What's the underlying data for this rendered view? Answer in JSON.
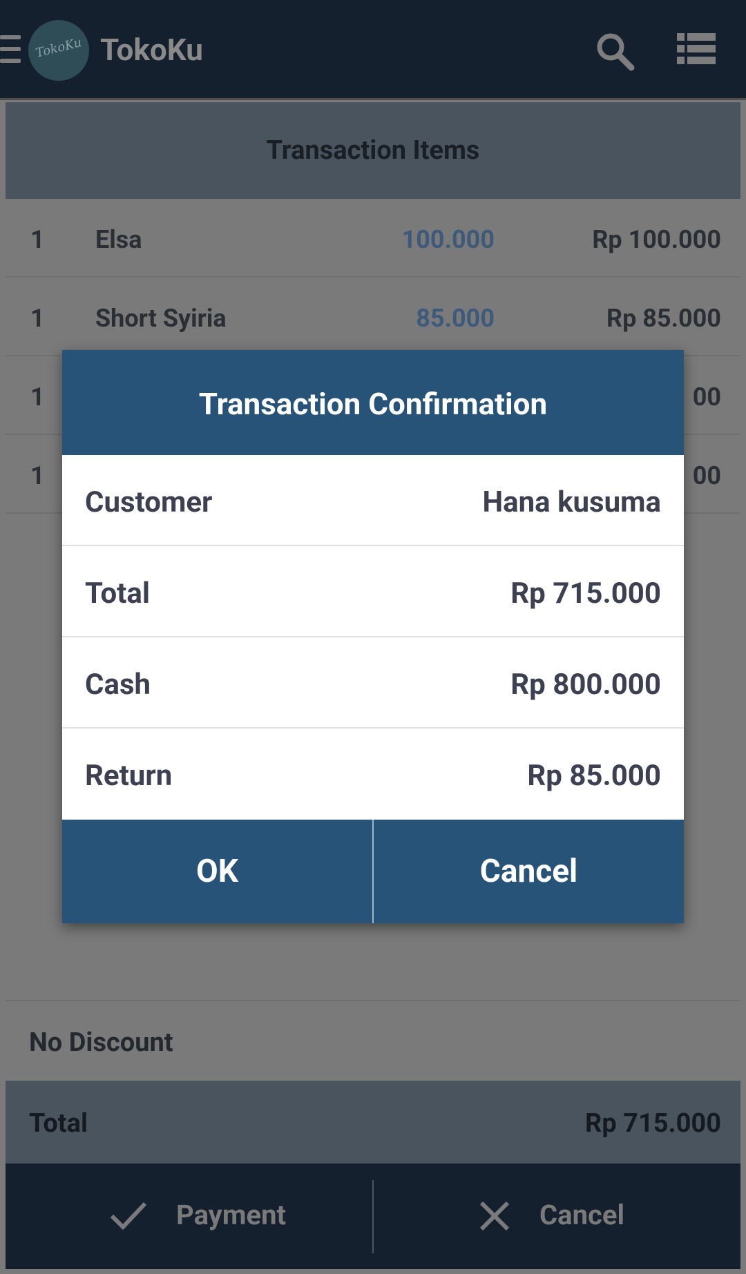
{
  "app": {
    "title": "TokoKu",
    "logo_text": "TokoKu"
  },
  "items": {
    "header": "Transaction Items",
    "rows": [
      {
        "qty": "1",
        "name": "Elsa",
        "price": "100.000",
        "subtotal": "Rp 100.000"
      },
      {
        "qty": "1",
        "name": "Short Syiria",
        "price": "85.000",
        "subtotal": "Rp 85.000"
      },
      {
        "qty": "1",
        "name": "",
        "price": "",
        "subtotal": "00"
      },
      {
        "qty": "1",
        "name": "",
        "price": "",
        "subtotal": "00"
      }
    ]
  },
  "discount": {
    "label": "No Discount"
  },
  "total": {
    "label": "Total",
    "value": "Rp 715.000"
  },
  "bottom": {
    "payment_label": "Payment",
    "cancel_label": "Cancel"
  },
  "dialog": {
    "title": "Transaction Confirmation",
    "rows": [
      {
        "label": "Customer",
        "value": "Hana kusuma"
      },
      {
        "label": "Total",
        "value": "Rp 715.000"
      },
      {
        "label": "Cash",
        "value": "Rp 800.000"
      },
      {
        "label": "Return",
        "value": "Rp 85.000"
      }
    ],
    "ok_label": "OK",
    "cancel_label": "Cancel"
  },
  "colors": {
    "appbar": "#14202e",
    "dialog_accent": "#285378",
    "price_text": "#3e5a7a",
    "overlay_gray": "#7a7a7a"
  }
}
